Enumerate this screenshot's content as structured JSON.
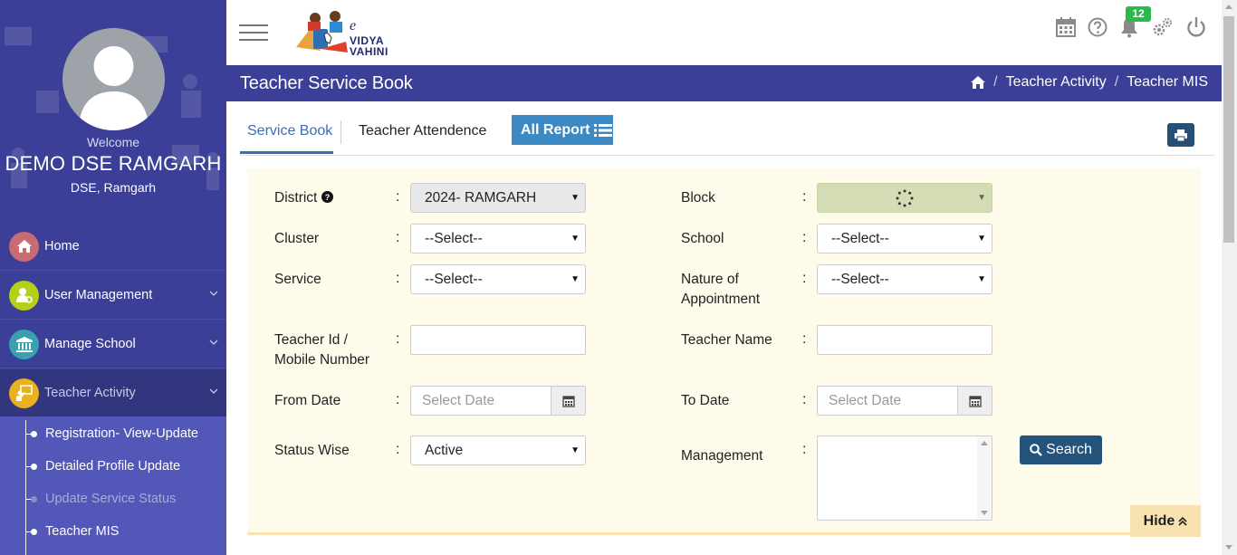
{
  "sidebar": {
    "welcome": "Welcome",
    "user_name": "DEMO DSE RAMGARH",
    "user_role": "DSE, Ramgarh",
    "menu": [
      {
        "label": "Home",
        "icon": "home-icon",
        "color": "#c96b72"
      },
      {
        "label": "User Management",
        "icon": "user-gear-icon",
        "color": "#b3d11b"
      },
      {
        "label": "Manage School",
        "icon": "bank-icon",
        "color": "#3aa0b0"
      },
      {
        "label": "Teacher Activity",
        "icon": "teacher-board-icon",
        "color": "#e9b21d"
      }
    ],
    "submenu": [
      {
        "label": "Registration- View-Update"
      },
      {
        "label": "Detailed Profile Update"
      },
      {
        "label": "Update Service Status"
      },
      {
        "label": "Teacher MIS"
      }
    ]
  },
  "topbar": {
    "logo_text_small": "e",
    "logo_text_1": "VIDYA",
    "logo_text_2": "VAHINI",
    "notification_count": "12",
    "colors": {
      "badge": "#2bb94a"
    }
  },
  "titlebar": {
    "title": "Teacher Service Book",
    "breadcrumb": [
      "Teacher Activity",
      "Teacher MIS"
    ],
    "sep": "/"
  },
  "tabs": {
    "items": [
      "Service Book",
      "Teacher Attendence"
    ],
    "all_report": "All Report"
  },
  "form": {
    "colon": ":",
    "district_label": "District",
    "district_value": "2024- RAMGARH",
    "block_label": "Block",
    "cluster_label": "Cluster",
    "cluster_value": "--Select--",
    "school_label": "School",
    "school_value": "--Select--",
    "service_label": "Service",
    "service_value": "--Select--",
    "nature_label_1": "Nature of",
    "nature_label_2": "Appointment",
    "nature_value": "--Select--",
    "teacher_id_label_1": "Teacher Id /",
    "teacher_id_label_2": "Mobile Number",
    "teacher_name_label": "Teacher Name",
    "from_date_label": "From Date",
    "from_date_placeholder": "Select Date",
    "to_date_label": "To Date",
    "to_date_placeholder": "Select Date",
    "status_label": "Status Wise",
    "status_value": "Active",
    "management_label": "Management",
    "search_label": "Search",
    "hide_label": "Hide"
  }
}
